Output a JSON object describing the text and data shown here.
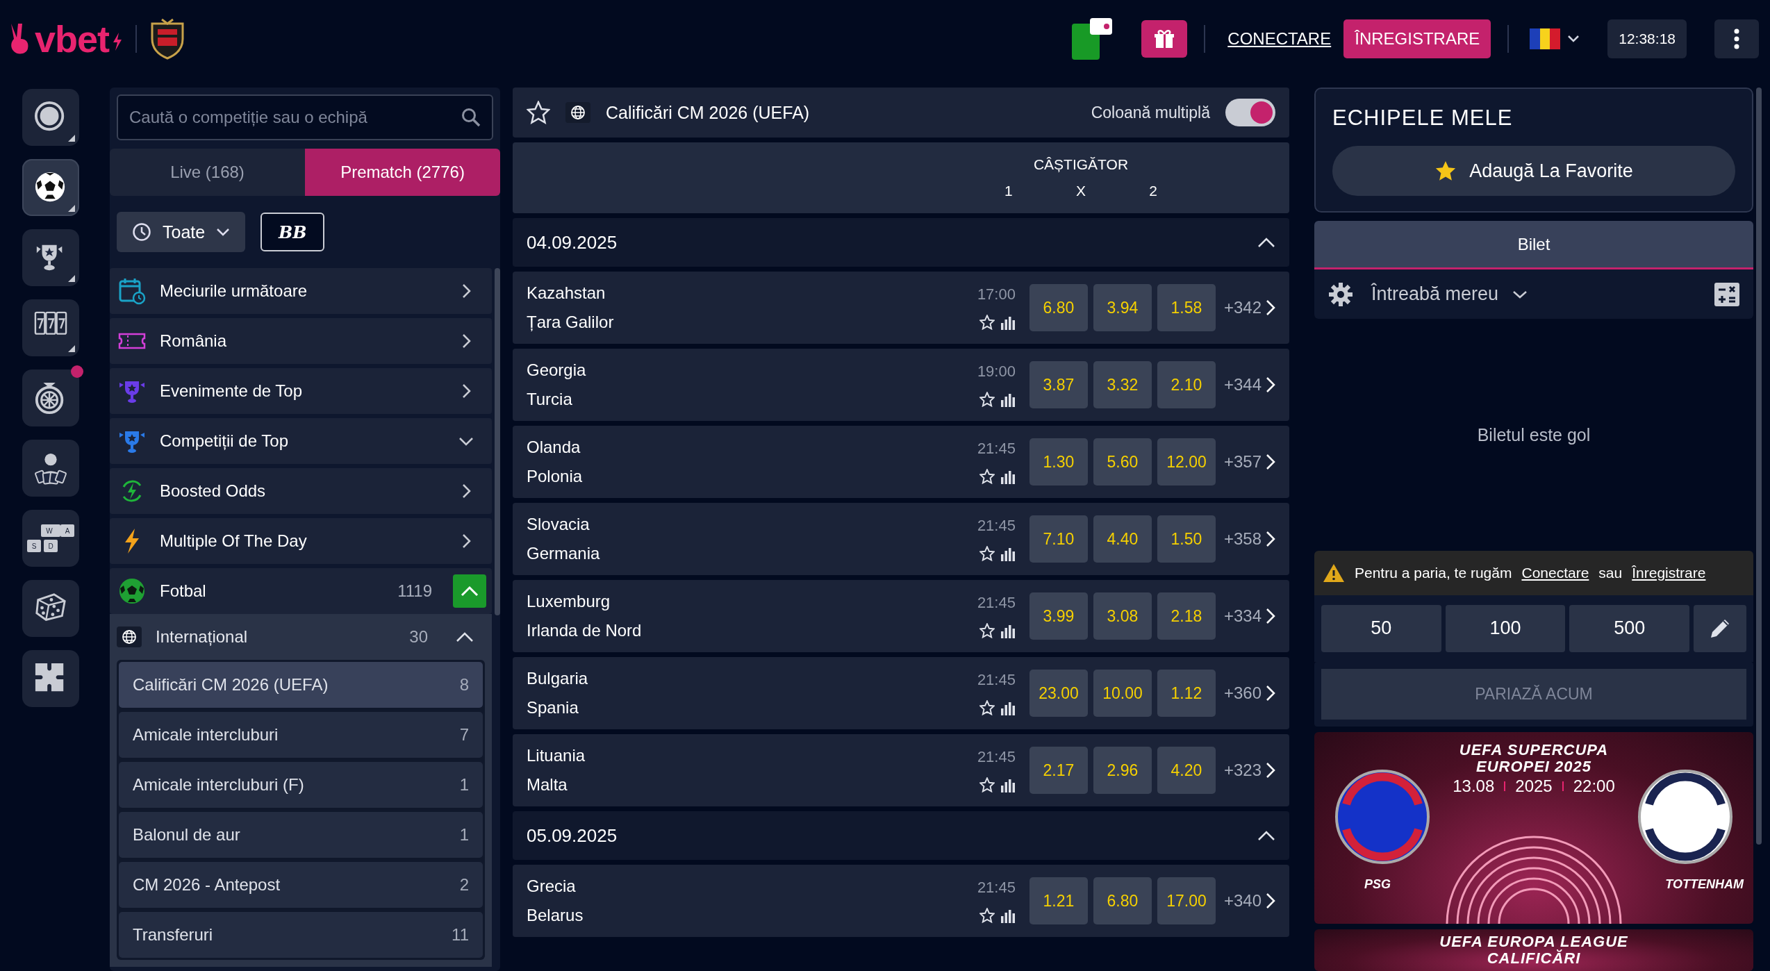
{
  "header": {
    "logo": "vbet",
    "connect": "CONECTARE",
    "register": "ÎNREGISTRARE",
    "time": "12:38:18"
  },
  "rail": [
    {
      "kind": "live",
      "selected": false,
      "submenu": true,
      "notification": false
    },
    {
      "kind": "football",
      "selected": true,
      "submenu": true,
      "notification": false
    },
    {
      "kind": "trophy",
      "selected": false,
      "submenu": true,
      "notification": false
    },
    {
      "kind": "slots",
      "selected": false,
      "submenu": true,
      "notification": false
    },
    {
      "kind": "wheel",
      "selected": false,
      "submenu": false,
      "notification": true
    },
    {
      "kind": "dealer",
      "selected": false,
      "submenu": false,
      "notification": false
    },
    {
      "kind": "keys",
      "selected": false,
      "submenu": false,
      "notification": false,
      "keys": [
        "W",
        "A",
        "S",
        "D"
      ]
    },
    {
      "kind": "dice",
      "selected": false,
      "submenu": false,
      "notification": false
    },
    {
      "kind": "puzzle",
      "selected": false,
      "submenu": false,
      "notification": false
    }
  ],
  "left": {
    "search": {
      "placeholder": "Caută o competiție sau o echipă"
    },
    "tabs": [
      {
        "label": "Live (168)",
        "selected": false
      },
      {
        "label": "Prematch (2776)",
        "selected": true
      }
    ],
    "filter": "Toate",
    "bb": "BB",
    "menu": [
      {
        "label": "Meciurile următoare",
        "kind": "link"
      },
      {
        "label": "România",
        "kind": "link"
      },
      {
        "label": "Evenimente de Top",
        "kind": "link"
      },
      {
        "label": "Competiții de Top",
        "kind": "group"
      },
      {
        "label": "Boosted Odds",
        "kind": "link"
      },
      {
        "label": "Multiple Of The Day",
        "kind": "link"
      }
    ],
    "sport": {
      "name": "Fotbal",
      "count": "1119",
      "expanded": true
    },
    "region": {
      "name": "Internațional",
      "count": "30",
      "expanded": true
    },
    "competitions": [
      {
        "name": "Calificări CM 2026 (UEFA)",
        "count": "8",
        "selected": true
      },
      {
        "name": "Amicale intercluburi",
        "count": "7",
        "selected": false
      },
      {
        "name": "Amicale intercluburi (F)",
        "count": "1",
        "selected": false
      },
      {
        "name": "Balonul de aur",
        "count": "1",
        "selected": false
      },
      {
        "name": "CM 2026 - Antepost",
        "count": "2",
        "selected": false
      },
      {
        "name": "Transferuri",
        "count": "11",
        "selected": false
      }
    ]
  },
  "center": {
    "title": "Calificări CM 2026 (UEFA)",
    "favorite": false,
    "multi_column": {
      "label": "Coloană multiplă",
      "on": true
    },
    "market": "CÂȘTIGĂTOR",
    "outcomes": [
      "1",
      "X",
      "2"
    ],
    "days": [
      {
        "date": "04.09.2025",
        "expanded": true,
        "matches": [
          {
            "home": "Kazahstan",
            "away": "Țara Galilor",
            "time": "17:00",
            "odds": [
              "6.80",
              "3.94",
              "1.58"
            ],
            "more": "+342"
          },
          {
            "home": "Georgia",
            "away": "Turcia",
            "time": "19:00",
            "odds": [
              "3.87",
              "3.32",
              "2.10"
            ],
            "more": "+344"
          },
          {
            "home": "Olanda",
            "away": "Polonia",
            "time": "21:45",
            "odds": [
              "1.30",
              "5.60",
              "12.00"
            ],
            "more": "+357"
          },
          {
            "home": "Slovacia",
            "away": "Germania",
            "time": "21:45",
            "odds": [
              "7.10",
              "4.40",
              "1.50"
            ],
            "more": "+358"
          },
          {
            "home": "Luxemburg",
            "away": "Irlanda de Nord",
            "time": "21:45",
            "odds": [
              "3.99",
              "3.08",
              "2.18"
            ],
            "more": "+334"
          },
          {
            "home": "Bulgaria",
            "away": "Spania",
            "time": "21:45",
            "odds": [
              "23.00",
              "10.00",
              "1.12"
            ],
            "more": "+360"
          },
          {
            "home": "Lituania",
            "away": "Malta",
            "time": "21:45",
            "odds": [
              "2.17",
              "2.96",
              "4.20"
            ],
            "more": "+323"
          }
        ]
      },
      {
        "date": "05.09.2025",
        "expanded": true,
        "matches": [
          {
            "home": "Grecia",
            "away": "Belarus",
            "time": "21:45",
            "odds": [
              "1.21",
              "6.80",
              "17.00"
            ],
            "more": "+340"
          }
        ]
      }
    ]
  },
  "right": {
    "my_teams": {
      "title": "ECHIPELE MELE",
      "add": "Adaugă La Favorite"
    },
    "tabs": [
      {
        "label": "Bilet",
        "selected": true
      }
    ],
    "setting": "Întreabă mereu",
    "empty": "Biletul este gol",
    "warning": {
      "text": "Pentru a paria, te rugăm",
      "login": "Conectare",
      "or": "sau",
      "register": "Înregistrare"
    },
    "stakes": [
      "50",
      "100",
      "500"
    ],
    "place_bet": {
      "label": "PARIAZĂ ACUM",
      "disabled": true
    },
    "banners": [
      {
        "title": [
          "UEFA SUPERCUPA",
          "EUROPEI 2025"
        ],
        "date": "13.08",
        "year": "2025",
        "time": "22:00",
        "home": "PSG",
        "away": "TOTTENHAM"
      },
      {
        "title": [
          "UEFA EUROPA LEAGUE",
          "CALIFICĂRI"
        ]
      }
    ]
  }
}
